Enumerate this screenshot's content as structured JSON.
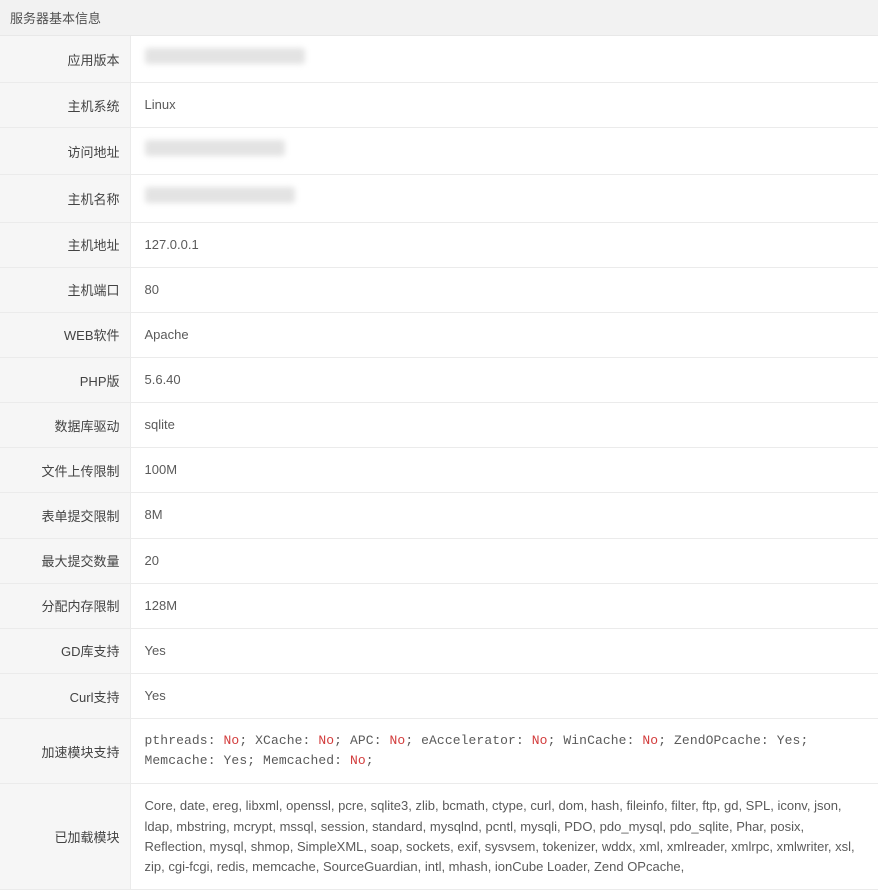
{
  "header": "服务器基本信息",
  "rows": {
    "app_version": {
      "label": "应用版本",
      "value": ""
    },
    "host_os": {
      "label": "主机系统",
      "value": "Linux"
    },
    "access_url": {
      "label": "访问地址",
      "value": ""
    },
    "host_name": {
      "label": "主机名称",
      "value": ""
    },
    "host_addr": {
      "label": "主机地址",
      "value": "127.0.0.1"
    },
    "host_port": {
      "label": "主机端口",
      "value": "80"
    },
    "web_software": {
      "label": "WEB软件",
      "value": "Apache"
    },
    "php_ver": {
      "label": "PHP版",
      "value": "5.6.40"
    },
    "db_driver": {
      "label": "数据库驱动",
      "value": "sqlite"
    },
    "upload_limit": {
      "label": "文件上传限制",
      "value": "100M"
    },
    "post_limit": {
      "label": "表单提交限制",
      "value": "8M"
    },
    "max_post_count": {
      "label": "最大提交数量",
      "value": "20"
    },
    "mem_limit": {
      "label": "分配内存限制",
      "value": "128M"
    },
    "gd_support": {
      "label": "GD库支持",
      "value": "Yes"
    },
    "curl_support": {
      "label": "Curl支持",
      "value": "Yes"
    },
    "accel_modules": {
      "label": "加速模块支持"
    },
    "loaded_modules": {
      "label": "已加载模块",
      "value": "Core, date, ereg, libxml, openssl, pcre, sqlite3, zlib, bcmath, ctype, curl, dom, hash, fileinfo, filter, ftp, gd, SPL, iconv, json, ldap, mbstring, mcrypt, mssql, session, standard, mysqlnd, pcntl, mysqli, PDO, pdo_mysql, pdo_sqlite, Phar, posix, Reflection, mysql, shmop, SimpleXML, soap, sockets, exif, sysvsem, tokenizer, wddx, xml, xmlreader, xmlrpc, xmlwriter, xsl, zip, cgi-fcgi, redis, memcache, SourceGuardian, intl, mhash, ionCube Loader, Zend OPcache,"
    }
  },
  "accel_items": [
    {
      "name": "pthreads",
      "status": "No",
      "ok": false
    },
    {
      "name": "XCache",
      "status": "No",
      "ok": false
    },
    {
      "name": "APC",
      "status": "No",
      "ok": false
    },
    {
      "name": "eAccelerator",
      "status": "No",
      "ok": false
    },
    {
      "name": "WinCache",
      "status": "No",
      "ok": false
    },
    {
      "name": "ZendOPcache",
      "status": "Yes",
      "ok": true
    },
    {
      "name": "Memcache",
      "status": "Yes",
      "ok": true
    },
    {
      "name": "Memcached",
      "status": "No",
      "ok": false
    }
  ]
}
